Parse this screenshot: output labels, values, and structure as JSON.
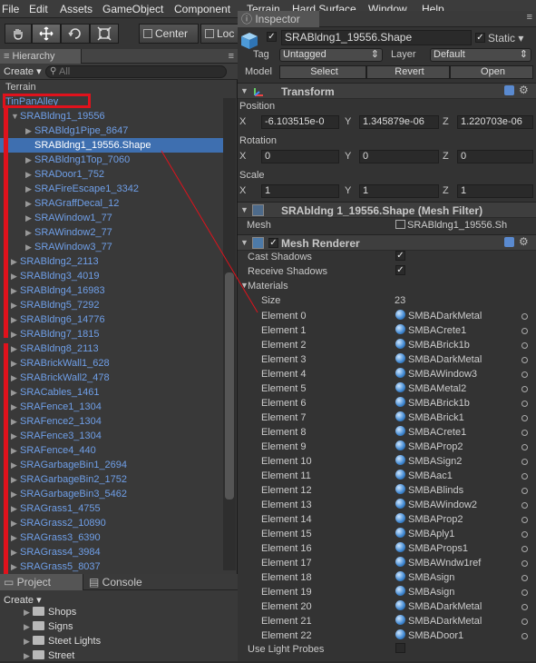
{
  "menubar": {
    "items": [
      "File",
      "Edit",
      "Assets",
      "GameObject",
      "Component",
      "Terrain",
      "Hard Surface",
      "Window",
      "Help"
    ]
  },
  "toolbar": {
    "center_label": "Center",
    "local_label": "Loc"
  },
  "hierarchy": {
    "tab_label": "Hierarchy",
    "create_label": "Create ▾",
    "search_placeholder": "All",
    "rows": [
      {
        "label": "Terrain",
        "indent": 0,
        "arrow": "",
        "blue": false
      },
      {
        "label": "TinPanAlley",
        "indent": 0,
        "arrow": "",
        "blue": true
      },
      {
        "label": "SRABldng1_19556",
        "indent": 1,
        "arrow": "▼",
        "blue": true
      },
      {
        "label": "SRABldg1Pipe_8647",
        "indent": 2,
        "arrow": "▶",
        "blue": true
      },
      {
        "label": "SRABldng1_19556.Shape",
        "indent": 2,
        "arrow": "",
        "blue": false,
        "selected": true
      },
      {
        "label": "SRABldng1Top_7060",
        "indent": 2,
        "arrow": "▶",
        "blue": true
      },
      {
        "label": "SRADoor1_752",
        "indent": 2,
        "arrow": "▶",
        "blue": true
      },
      {
        "label": "SRAFireEscape1_3342",
        "indent": 2,
        "arrow": "▶",
        "blue": true
      },
      {
        "label": "SRAGraffDecal_12",
        "indent": 2,
        "arrow": "▶",
        "blue": true
      },
      {
        "label": "SRAWindow1_77",
        "indent": 2,
        "arrow": "▶",
        "blue": true
      },
      {
        "label": "SRAWindow2_77",
        "indent": 2,
        "arrow": "▶",
        "blue": true
      },
      {
        "label": "SRAWindow3_77",
        "indent": 2,
        "arrow": "▶",
        "blue": true
      },
      {
        "label": "SRABldng2_2113",
        "indent": 1,
        "arrow": "▶",
        "blue": true
      },
      {
        "label": "SRABldng3_4019",
        "indent": 1,
        "arrow": "▶",
        "blue": true
      },
      {
        "label": "SRABldng4_16983",
        "indent": 1,
        "arrow": "▶",
        "blue": true
      },
      {
        "label": "SRABldng5_7292",
        "indent": 1,
        "arrow": "▶",
        "blue": true
      },
      {
        "label": "SRABldng6_14776",
        "indent": 1,
        "arrow": "▶",
        "blue": true
      },
      {
        "label": "SRABldng7_1815",
        "indent": 1,
        "arrow": "▶",
        "blue": true
      },
      {
        "label": "SRABldng8_2113",
        "indent": 1,
        "arrow": "▶",
        "blue": true
      },
      {
        "label": "SRABrickWall1_628",
        "indent": 1,
        "arrow": "▶",
        "blue": true
      },
      {
        "label": "SRABrickWall2_478",
        "indent": 1,
        "arrow": "▶",
        "blue": true
      },
      {
        "label": "SRACables_1461",
        "indent": 1,
        "arrow": "▶",
        "blue": true
      },
      {
        "label": "SRAFence1_1304",
        "indent": 1,
        "arrow": "▶",
        "blue": true
      },
      {
        "label": "SRAFence2_1304",
        "indent": 1,
        "arrow": "▶",
        "blue": true
      },
      {
        "label": "SRAFence3_1304",
        "indent": 1,
        "arrow": "▶",
        "blue": true
      },
      {
        "label": "SRAFence4_440",
        "indent": 1,
        "arrow": "▶",
        "blue": true
      },
      {
        "label": "SRAGarbageBin1_2694",
        "indent": 1,
        "arrow": "▶",
        "blue": true
      },
      {
        "label": "SRAGarbageBin2_1752",
        "indent": 1,
        "arrow": "▶",
        "blue": true
      },
      {
        "label": "SRAGarbageBin3_5462",
        "indent": 1,
        "arrow": "▶",
        "blue": true
      },
      {
        "label": "SRAGrass1_4755",
        "indent": 1,
        "arrow": "▶",
        "blue": true
      },
      {
        "label": "SRAGrass2_10890",
        "indent": 1,
        "arrow": "▶",
        "blue": true
      },
      {
        "label": "SRAGrass3_6390",
        "indent": 1,
        "arrow": "▶",
        "blue": true
      },
      {
        "label": "SRAGrass4_3984",
        "indent": 1,
        "arrow": "▶",
        "blue": true
      },
      {
        "label": "SRAGrass5_8037",
        "indent": 1,
        "arrow": "▶",
        "blue": true
      }
    ]
  },
  "project": {
    "tab_project": "Project",
    "tab_console": "Console",
    "create_label": "Create ▾",
    "folders": [
      "Shops",
      "Signs",
      "Steet Lights",
      "Street"
    ]
  },
  "inspector": {
    "tab_label": "Inspector",
    "object_name": "SRABldng1_19556.Shape",
    "static_label": "Static ▾",
    "tag_label": "Tag",
    "tag_value": "Untagged",
    "layer_label": "Layer",
    "layer_value": "Default",
    "model_label": "Model",
    "select_label": "Select",
    "revert_label": "Revert",
    "open_label": "Open",
    "transform": {
      "title": "Transform",
      "position_label": "Position",
      "rotation_label": "Rotation",
      "scale_label": "Scale",
      "position": {
        "x": "-6.103515e-0",
        "y": "1.345879e-06",
        "z": "1.220703e-06"
      },
      "rotation": {
        "x": "0",
        "y": "0",
        "z": "0"
      },
      "scale": {
        "x": "1",
        "y": "1",
        "z": "1"
      }
    },
    "mesh_filter": {
      "title": "SRAbldng 1_19556.Shape (Mesh Filter)",
      "mesh_label": "Mesh",
      "mesh_value": "SRABldng1_19556.Sh"
    },
    "mesh_renderer": {
      "title": "Mesh Renderer",
      "cast_shadows_label": "Cast Shadows",
      "receive_shadows_label": "Receive Shadows",
      "materials_label": "Materials",
      "size_label": "Size",
      "size_value": "23",
      "use_light_probes_label": "Use Light Probes",
      "elements": [
        {
          "label": "Element 0",
          "value": "SMBADarkMetal"
        },
        {
          "label": "Element 1",
          "value": "SMBACrete1"
        },
        {
          "label": "Element 2",
          "value": "SMBABrick1b"
        },
        {
          "label": "Element 3",
          "value": "SMBADarkMetal"
        },
        {
          "label": "Element 4",
          "value": "SMBAWindow3"
        },
        {
          "label": "Element 5",
          "value": "SMBAMetal2"
        },
        {
          "label": "Element 6",
          "value": "SMBABrick1b"
        },
        {
          "label": "Element 7",
          "value": "SMBABrick1"
        },
        {
          "label": "Element 8",
          "value": "SMBACrete1"
        },
        {
          "label": "Element 9",
          "value": "SMBAProp2"
        },
        {
          "label": "Element 10",
          "value": "SMBASign2"
        },
        {
          "label": "Element 11",
          "value": "SMBAac1"
        },
        {
          "label": "Element 12",
          "value": "SMBABlinds"
        },
        {
          "label": "Element 13",
          "value": "SMBAWindow2"
        },
        {
          "label": "Element 14",
          "value": "SMBAProp2"
        },
        {
          "label": "Element 15",
          "value": "SMBAply1"
        },
        {
          "label": "Element 16",
          "value": "SMBAProps1"
        },
        {
          "label": "Element 17",
          "value": "SMBAWndw1ref"
        },
        {
          "label": "Element 18",
          "value": "SMBAsign"
        },
        {
          "label": "Element 19",
          "value": "SMBAsign"
        },
        {
          "label": "Element 20",
          "value": "SMBADarkMetal"
        },
        {
          "label": "Element 21",
          "value": "SMBADarkMetal"
        },
        {
          "label": "Element 22",
          "value": "SMBADoor1"
        }
      ]
    }
  }
}
